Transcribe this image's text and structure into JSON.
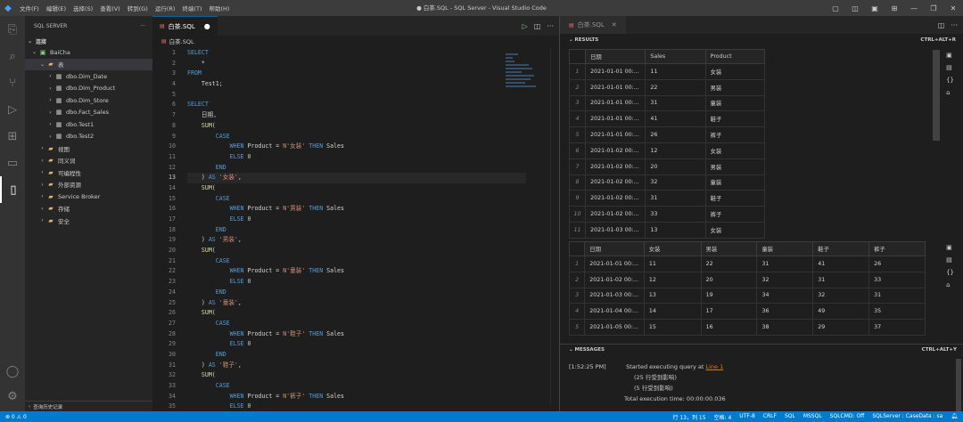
{
  "app": {
    "window_title": "● 白茶.SQL - SQL Server - Visual Studio Code",
    "menu": [
      "文件(F)",
      "编辑(E)",
      "选择(S)",
      "查看(V)",
      "转到(G)",
      "运行(R)",
      "终端(T)",
      "帮助(H)"
    ]
  },
  "sidebar": {
    "title": "SQL SERVER",
    "section": "连接",
    "footer": "查询历史记录",
    "tree": [
      {
        "label": "BaiCha",
        "type": "server",
        "indent": 0,
        "expanded": true
      },
      {
        "label": "表",
        "type": "folder",
        "indent": 1,
        "expanded": true,
        "selected": true
      },
      {
        "label": "dbo.Dim_Date",
        "type": "table",
        "indent": 2
      },
      {
        "label": "dbo.Dim_Product",
        "type": "table",
        "indent": 2
      },
      {
        "label": "dbo.Dim_Store",
        "type": "table",
        "indent": 2
      },
      {
        "label": "dbo.Fact_Sales",
        "type": "table",
        "indent": 2
      },
      {
        "label": "dbo.Test1",
        "type": "table",
        "indent": 2
      },
      {
        "label": "dbo.Test2",
        "type": "table",
        "indent": 2
      },
      {
        "label": "视图",
        "type": "folder",
        "indent": 1
      },
      {
        "label": "同义词",
        "type": "folder",
        "indent": 1
      },
      {
        "label": "可编程性",
        "type": "folder",
        "indent": 1
      },
      {
        "label": "外部资源",
        "type": "folder",
        "indent": 1
      },
      {
        "label": "Service Broker",
        "type": "folder",
        "indent": 1
      },
      {
        "label": "存储",
        "type": "folder",
        "indent": 1
      },
      {
        "label": "安全",
        "type": "folder",
        "indent": 1
      }
    ]
  },
  "editor": {
    "tab_label": "白茶.SQL",
    "breadcrumb": "白茶.SQL",
    "current_line": 13,
    "line_numbers": [
      "1",
      "2",
      "3",
      "4",
      "5",
      "6",
      "7",
      "8",
      "9",
      "10",
      "11",
      "12",
      "13",
      "14",
      "15",
      "16",
      "17",
      "18",
      "19",
      "20",
      "21",
      "22",
      "23",
      "24",
      "25",
      "26",
      "27",
      "28",
      "29",
      "30",
      "31",
      "32",
      "33",
      "34",
      "35"
    ],
    "lines": [
      [
        [
          "kw",
          "SELECT"
        ]
      ],
      [
        [
          "op",
          "    *"
        ]
      ],
      [
        [
          "kw",
          "FROM"
        ]
      ],
      [
        [
          "ident",
          "    Test1;"
        ]
      ],
      [
        [
          "ident",
          ""
        ]
      ],
      [
        [
          "kw",
          "SELECT"
        ]
      ],
      [
        [
          "ident",
          "    日期,"
        ]
      ],
      [
        [
          "fn",
          "    SUM"
        ],
        [
          "op",
          "("
        ]
      ],
      [
        [
          "kw",
          "        CASE"
        ]
      ],
      [
        [
          "kw",
          "            WHEN "
        ],
        [
          "ident",
          "Product = "
        ],
        [
          "str",
          "N'女装'"
        ],
        [
          "kw",
          " THEN "
        ],
        [
          "ident",
          "Sales"
        ]
      ],
      [
        [
          "kw",
          "            ELSE "
        ],
        [
          "num",
          "0"
        ]
      ],
      [
        [
          "kw",
          "        END"
        ]
      ],
      [
        [
          "op",
          "    ) "
        ],
        [
          "kw",
          "AS "
        ],
        [
          "str",
          "'女装'"
        ],
        [
          "op",
          ","
        ]
      ],
      [
        [
          "fn",
          "    SUM"
        ],
        [
          "op",
          "("
        ]
      ],
      [
        [
          "kw",
          "        CASE"
        ]
      ],
      [
        [
          "kw",
          "            WHEN "
        ],
        [
          "ident",
          "Product = "
        ],
        [
          "str",
          "N'男装'"
        ],
        [
          "kw",
          " THEN "
        ],
        [
          "ident",
          "Sales"
        ]
      ],
      [
        [
          "kw",
          "            ELSE "
        ],
        [
          "num",
          "0"
        ]
      ],
      [
        [
          "kw",
          "        END"
        ]
      ],
      [
        [
          "op",
          "    ) "
        ],
        [
          "kw",
          "AS "
        ],
        [
          "str",
          "'男装'"
        ],
        [
          "op",
          ","
        ]
      ],
      [
        [
          "fn",
          "    SUM"
        ],
        [
          "op",
          "("
        ]
      ],
      [
        [
          "kw",
          "        CASE"
        ]
      ],
      [
        [
          "kw",
          "            WHEN "
        ],
        [
          "ident",
          "Product = "
        ],
        [
          "str",
          "N'童装'"
        ],
        [
          "kw",
          " THEN "
        ],
        [
          "ident",
          "Sales"
        ]
      ],
      [
        [
          "kw",
          "            ELSE "
        ],
        [
          "num",
          "0"
        ]
      ],
      [
        [
          "kw",
          "        END"
        ]
      ],
      [
        [
          "op",
          "    ) "
        ],
        [
          "kw",
          "AS "
        ],
        [
          "str",
          "'童装'"
        ],
        [
          "op",
          ","
        ]
      ],
      [
        [
          "fn",
          "    SUM"
        ],
        [
          "op",
          "("
        ]
      ],
      [
        [
          "kw",
          "        CASE"
        ]
      ],
      [
        [
          "kw",
          "            WHEN "
        ],
        [
          "ident",
          "Product = "
        ],
        [
          "str",
          "N'鞋子'"
        ],
        [
          "kw",
          " THEN "
        ],
        [
          "ident",
          "Sales"
        ]
      ],
      [
        [
          "kw",
          "            ELSE "
        ],
        [
          "num",
          "0"
        ]
      ],
      [
        [
          "kw",
          "        END"
        ]
      ],
      [
        [
          "op",
          "    ) "
        ],
        [
          "kw",
          "AS "
        ],
        [
          "str",
          "'鞋子'"
        ],
        [
          "op",
          ","
        ]
      ],
      [
        [
          "fn",
          "    SUM"
        ],
        [
          "op",
          "("
        ]
      ],
      [
        [
          "kw",
          "        CASE"
        ]
      ],
      [
        [
          "kw",
          "            WHEN "
        ],
        [
          "ident",
          "Product = "
        ],
        [
          "str",
          "N'裤子'"
        ],
        [
          "kw",
          " THEN "
        ],
        [
          "ident",
          "Sales"
        ]
      ],
      [
        [
          "kw",
          "            ELSE "
        ],
        [
          "num",
          "0"
        ]
      ]
    ]
  },
  "results": {
    "tab_label": "白茶.SQL",
    "results_header": "RESULTS",
    "messages_header": "MESSAGES",
    "shortcut_results": "CTRL+ALT+R",
    "shortcut_messages": "CTRL+ALT+Y",
    "grid1": {
      "columns": [
        "日期",
        "Sales",
        "Product"
      ],
      "rows": [
        [
          "1",
          "2021-01-01 00:...",
          "11",
          "女装"
        ],
        [
          "2",
          "2021-01-01 00:...",
          "22",
          "男装"
        ],
        [
          "3",
          "2021-01-01 00:...",
          "31",
          "童装"
        ],
        [
          "4",
          "2021-01-01 00:...",
          "41",
          "鞋子"
        ],
        [
          "5",
          "2021-01-01 00:...",
          "26",
          "裤子"
        ],
        [
          "6",
          "2021-01-02 00:...",
          "12",
          "女装"
        ],
        [
          "7",
          "2021-01-02 00:...",
          "20",
          "男装"
        ],
        [
          "8",
          "2021-01-02 00:...",
          "32",
          "童装"
        ],
        [
          "9",
          "2021-01-02 00:...",
          "31",
          "鞋子"
        ],
        [
          "10",
          "2021-01-02 00:...",
          "33",
          "裤子"
        ],
        [
          "11",
          "2021-01-03 00:...",
          "13",
          "女装"
        ]
      ]
    },
    "grid2": {
      "columns": [
        "日期",
        "女装",
        "男装",
        "童装",
        "鞋子",
        "裤子"
      ],
      "rows": [
        [
          "1",
          "2021-01-01 00:...",
          "11",
          "22",
          "31",
          "41",
          "26"
        ],
        [
          "2",
          "2021-01-02 00:...",
          "12",
          "20",
          "32",
          "31",
          "33"
        ],
        [
          "3",
          "2021-01-03 00:...",
          "13",
          "19",
          "34",
          "32",
          "31"
        ],
        [
          "4",
          "2021-01-04 00:...",
          "14",
          "17",
          "36",
          "49",
          "35"
        ],
        [
          "5",
          "2021-01-05 00:...",
          "15",
          "16",
          "38",
          "29",
          "37"
        ]
      ]
    },
    "messages": {
      "time": "[1:52:25 PM]",
      "start_text": "Started executing query at ",
      "link": "Line 1",
      "affected1": "(25 行受到影响)",
      "affected2": "(5 行受到影响)",
      "total": "Total execution time: 00:00:00.036"
    }
  },
  "status": {
    "left": "⊗ 0  ⚠ 0",
    "items": [
      "行 13，列 15",
      "空格: 4",
      "UTF-8",
      "CRLF",
      "SQL",
      "MSSQL",
      "SQLCMD: Off",
      "SQLServer : CaseData : sa"
    ]
  }
}
